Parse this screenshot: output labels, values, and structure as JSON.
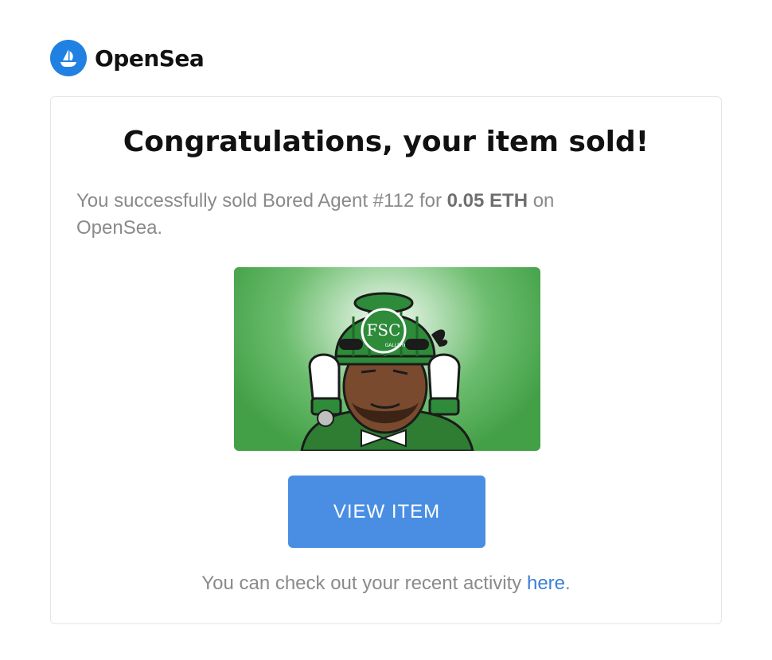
{
  "brand": {
    "name": "OpenSea",
    "accent": "#2081E2"
  },
  "email": {
    "title": "Congratulations, your item sold!",
    "message": {
      "prefix": "You successfully sold Bored Agent #112 for ",
      "price": "0.05 ETH",
      "suffix": " on OpenSea."
    },
    "image": {
      "alt": "Bored Agent #112",
      "cap_text": "FSC",
      "cap_subtext": "GALLERY"
    },
    "button": {
      "label": "VIEW ITEM",
      "color": "#4A8EE3"
    },
    "footer": {
      "prefix": "You can check out your recent activity ",
      "link": "here",
      "suffix": "."
    }
  }
}
